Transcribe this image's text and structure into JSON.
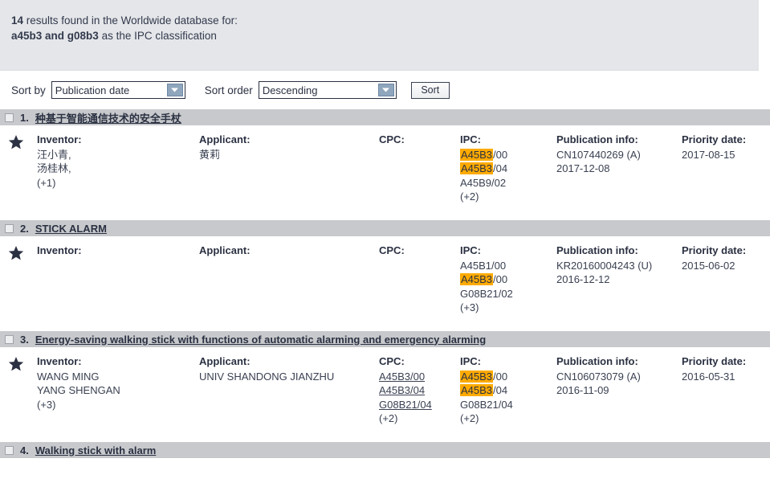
{
  "summary": {
    "count": "14",
    "line1_rest": " results found in the Worldwide database for:",
    "query": "a45b3 and g08b3",
    "line2_rest": " as the IPC classification"
  },
  "sortbar": {
    "sort_by_label": "Sort by",
    "sort_by_value": "Publication date",
    "sort_order_label": "Sort order",
    "sort_order_value": "Descending",
    "sort_button": "Sort"
  },
  "columns": {
    "inventor": "Inventor:",
    "applicant": "Applicant:",
    "cpc": "CPC:",
    "ipc": "IPC:",
    "publication": "Publication info:",
    "priority": "Priority date:"
  },
  "results": [
    {
      "index": "1.",
      "title": "种基于智能通信技术的安全手杖",
      "inventor": [
        "汪小青,",
        "汤桂林,",
        "(+1)"
      ],
      "applicant": [
        "黄莉"
      ],
      "cpc": [],
      "ipc": [
        {
          "hl": "A45B3",
          "rest": "/00"
        },
        {
          "hl": "A45B3",
          "rest": "/04"
        },
        {
          "hl": "",
          "rest": "A45B9/02"
        },
        {
          "hl": "",
          "rest": "(+2)"
        }
      ],
      "publication": [
        "CN107440269 (A)",
        "2017-12-08"
      ],
      "priority": [
        "2017-08-15"
      ]
    },
    {
      "index": "2.",
      "title": "STICK ALARM",
      "inventor": [],
      "applicant": [],
      "cpc": [],
      "ipc": [
        {
          "hl": "",
          "rest": "A45B1/00"
        },
        {
          "hl": "A45B3",
          "rest": "/00"
        },
        {
          "hl": "",
          "rest": "G08B21/02"
        },
        {
          "hl": "",
          "rest": "(+3)"
        }
      ],
      "publication": [
        "KR20160004243 (U)",
        "2016-12-12"
      ],
      "priority": [
        "2015-06-02"
      ]
    },
    {
      "index": "3.",
      "title": "Energy-saving walking stick with functions of automatic alarming and emergency alarming",
      "inventor": [
        "WANG MING",
        "YANG SHENGAN",
        "(+3)"
      ],
      "applicant": [
        "UNIV SHANDONG JIANZHU"
      ],
      "cpc": [
        {
          "link": true,
          "text": "A45B3/00"
        },
        {
          "link": true,
          "text": "A45B3/04"
        },
        {
          "link": true,
          "text": "G08B21/04"
        },
        {
          "link": false,
          "text": "(+2)"
        }
      ],
      "ipc": [
        {
          "hl": "A45B3",
          "rest": "/00"
        },
        {
          "hl": "A45B3",
          "rest": "/04"
        },
        {
          "hl": "",
          "rest": "G08B21/04"
        },
        {
          "hl": "",
          "rest": "(+2)"
        }
      ],
      "publication": [
        "CN106073079 (A)",
        "2016-11-09"
      ],
      "priority": [
        "2016-05-31"
      ]
    },
    {
      "index": "4.",
      "title": "Walking stick with alarm",
      "inventor": [],
      "applicant": [],
      "cpc": [],
      "ipc": [],
      "publication": [],
      "priority": []
    }
  ]
}
